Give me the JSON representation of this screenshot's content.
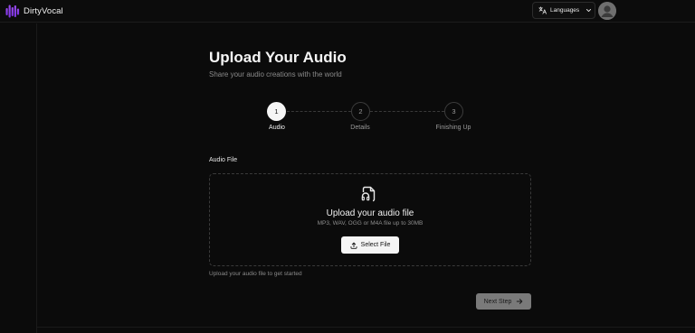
{
  "app": {
    "brand_name": "DirtyVocal",
    "brand_color": "#7c3aed"
  },
  "header": {
    "languages_label": "Languages",
    "languages_icon": "translate-icon",
    "chevron_icon": "chevron-down-icon",
    "avatar_icon": "user-avatar"
  },
  "page": {
    "title": "Upload Your Audio",
    "subtitle": "Share your audio creations with the world"
  },
  "stepper": {
    "steps": [
      {
        "number": "1",
        "label": "Audio",
        "state": "active"
      },
      {
        "number": "2",
        "label": "Details",
        "state": "inactive"
      },
      {
        "number": "3",
        "label": "Finishing Up",
        "state": "inactive"
      }
    ]
  },
  "upload": {
    "field_label": "Audio File",
    "icon": "audio-file-icon",
    "title": "Upload your audio file",
    "hint": "MP3, WAV, OGG or M4A file up to 30MB",
    "select_label": "Select File",
    "select_icon": "upload-icon",
    "helper_text": "Upload your audio file to get started"
  },
  "footer": {
    "next_label": "Next Step",
    "next_icon": "arrow-right-icon"
  }
}
